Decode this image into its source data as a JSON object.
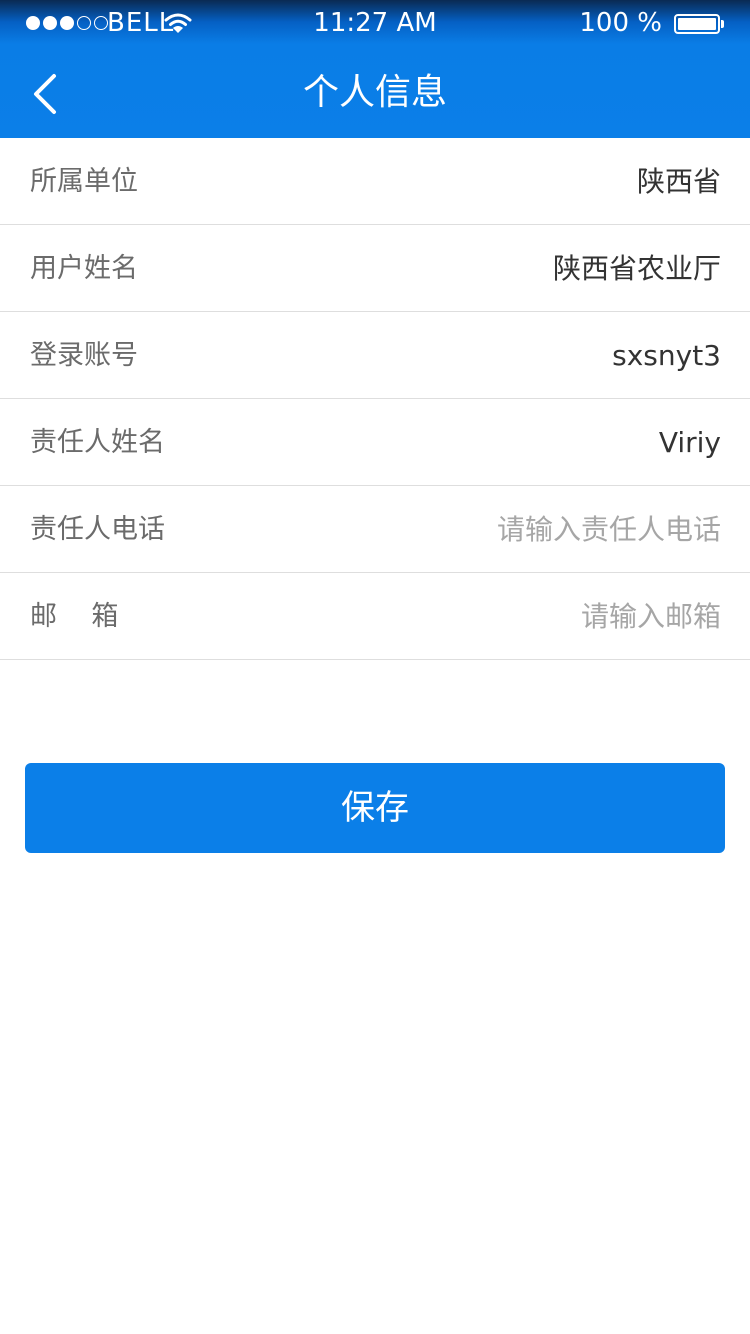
{
  "status_bar": {
    "carrier": "BELL",
    "time": "11:27 AM",
    "battery": "100 %"
  },
  "nav": {
    "title": "个人信息"
  },
  "form": {
    "unit": {
      "label": "所属单位",
      "value": "陕西省"
    },
    "user_name": {
      "label": "用户姓名",
      "value": "陕西省农业厅"
    },
    "account": {
      "label": "登录账号",
      "value": "sxsnyt3"
    },
    "contact_name": {
      "label": "责任人姓名",
      "value": "Viriy"
    },
    "contact_phone": {
      "label": "责任人电话",
      "placeholder": "请输入责任人电话"
    },
    "email": {
      "label": "邮    箱",
      "placeholder": "请输入邮箱"
    }
  },
  "actions": {
    "save_label": "保存"
  }
}
